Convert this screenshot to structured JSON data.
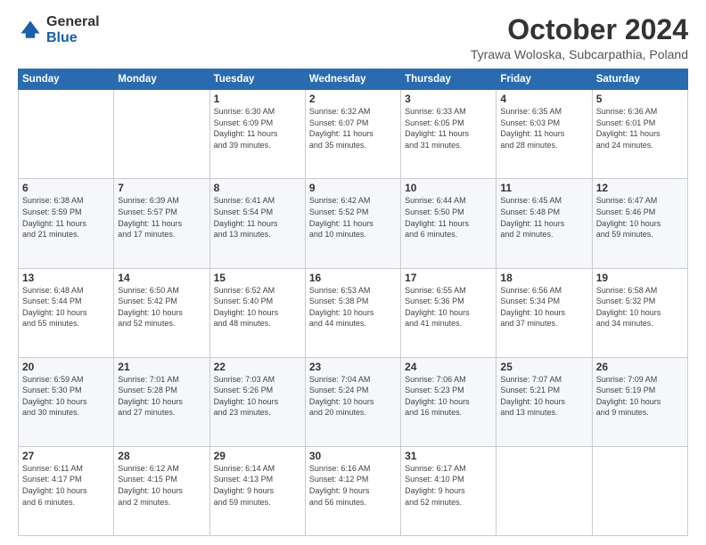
{
  "header": {
    "logo_general": "General",
    "logo_blue": "Blue",
    "month_title": "October 2024",
    "location": "Tyrawa Woloska, Subcarpathia, Poland"
  },
  "weekdays": [
    "Sunday",
    "Monday",
    "Tuesday",
    "Wednesday",
    "Thursday",
    "Friday",
    "Saturday"
  ],
  "weeks": [
    [
      {
        "day": "",
        "info": ""
      },
      {
        "day": "",
        "info": ""
      },
      {
        "day": "1",
        "info": "Sunrise: 6:30 AM\nSunset: 6:09 PM\nDaylight: 11 hours\nand 39 minutes."
      },
      {
        "day": "2",
        "info": "Sunrise: 6:32 AM\nSunset: 6:07 PM\nDaylight: 11 hours\nand 35 minutes."
      },
      {
        "day": "3",
        "info": "Sunrise: 6:33 AM\nSunset: 6:05 PM\nDaylight: 11 hours\nand 31 minutes."
      },
      {
        "day": "4",
        "info": "Sunrise: 6:35 AM\nSunset: 6:03 PM\nDaylight: 11 hours\nand 28 minutes."
      },
      {
        "day": "5",
        "info": "Sunrise: 6:36 AM\nSunset: 6:01 PM\nDaylight: 11 hours\nand 24 minutes."
      }
    ],
    [
      {
        "day": "6",
        "info": "Sunrise: 6:38 AM\nSunset: 5:59 PM\nDaylight: 11 hours\nand 21 minutes."
      },
      {
        "day": "7",
        "info": "Sunrise: 6:39 AM\nSunset: 5:57 PM\nDaylight: 11 hours\nand 17 minutes."
      },
      {
        "day": "8",
        "info": "Sunrise: 6:41 AM\nSunset: 5:54 PM\nDaylight: 11 hours\nand 13 minutes."
      },
      {
        "day": "9",
        "info": "Sunrise: 6:42 AM\nSunset: 5:52 PM\nDaylight: 11 hours\nand 10 minutes."
      },
      {
        "day": "10",
        "info": "Sunrise: 6:44 AM\nSunset: 5:50 PM\nDaylight: 11 hours\nand 6 minutes."
      },
      {
        "day": "11",
        "info": "Sunrise: 6:45 AM\nSunset: 5:48 PM\nDaylight: 11 hours\nand 2 minutes."
      },
      {
        "day": "12",
        "info": "Sunrise: 6:47 AM\nSunset: 5:46 PM\nDaylight: 10 hours\nand 59 minutes."
      }
    ],
    [
      {
        "day": "13",
        "info": "Sunrise: 6:48 AM\nSunset: 5:44 PM\nDaylight: 10 hours\nand 55 minutes."
      },
      {
        "day": "14",
        "info": "Sunrise: 6:50 AM\nSunset: 5:42 PM\nDaylight: 10 hours\nand 52 minutes."
      },
      {
        "day": "15",
        "info": "Sunrise: 6:52 AM\nSunset: 5:40 PM\nDaylight: 10 hours\nand 48 minutes."
      },
      {
        "day": "16",
        "info": "Sunrise: 6:53 AM\nSunset: 5:38 PM\nDaylight: 10 hours\nand 44 minutes."
      },
      {
        "day": "17",
        "info": "Sunrise: 6:55 AM\nSunset: 5:36 PM\nDaylight: 10 hours\nand 41 minutes."
      },
      {
        "day": "18",
        "info": "Sunrise: 6:56 AM\nSunset: 5:34 PM\nDaylight: 10 hours\nand 37 minutes."
      },
      {
        "day": "19",
        "info": "Sunrise: 6:58 AM\nSunset: 5:32 PM\nDaylight: 10 hours\nand 34 minutes."
      }
    ],
    [
      {
        "day": "20",
        "info": "Sunrise: 6:59 AM\nSunset: 5:30 PM\nDaylight: 10 hours\nand 30 minutes."
      },
      {
        "day": "21",
        "info": "Sunrise: 7:01 AM\nSunset: 5:28 PM\nDaylight: 10 hours\nand 27 minutes."
      },
      {
        "day": "22",
        "info": "Sunrise: 7:03 AM\nSunset: 5:26 PM\nDaylight: 10 hours\nand 23 minutes."
      },
      {
        "day": "23",
        "info": "Sunrise: 7:04 AM\nSunset: 5:24 PM\nDaylight: 10 hours\nand 20 minutes."
      },
      {
        "day": "24",
        "info": "Sunrise: 7:06 AM\nSunset: 5:23 PM\nDaylight: 10 hours\nand 16 minutes."
      },
      {
        "day": "25",
        "info": "Sunrise: 7:07 AM\nSunset: 5:21 PM\nDaylight: 10 hours\nand 13 minutes."
      },
      {
        "day": "26",
        "info": "Sunrise: 7:09 AM\nSunset: 5:19 PM\nDaylight: 10 hours\nand 9 minutes."
      }
    ],
    [
      {
        "day": "27",
        "info": "Sunrise: 6:11 AM\nSunset: 4:17 PM\nDaylight: 10 hours\nand 6 minutes."
      },
      {
        "day": "28",
        "info": "Sunrise: 6:12 AM\nSunset: 4:15 PM\nDaylight: 10 hours\nand 2 minutes."
      },
      {
        "day": "29",
        "info": "Sunrise: 6:14 AM\nSunset: 4:13 PM\nDaylight: 9 hours\nand 59 minutes."
      },
      {
        "day": "30",
        "info": "Sunrise: 6:16 AM\nSunset: 4:12 PM\nDaylight: 9 hours\nand 56 minutes."
      },
      {
        "day": "31",
        "info": "Sunrise: 6:17 AM\nSunset: 4:10 PM\nDaylight: 9 hours\nand 52 minutes."
      },
      {
        "day": "",
        "info": ""
      },
      {
        "day": "",
        "info": ""
      }
    ]
  ]
}
